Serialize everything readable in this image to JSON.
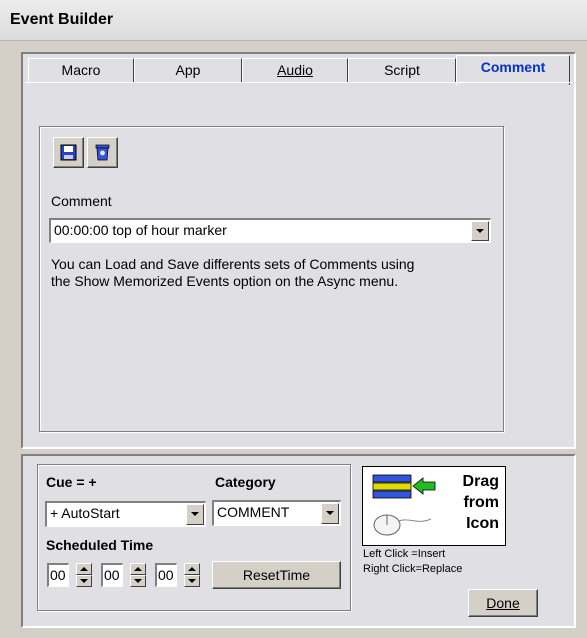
{
  "window": {
    "title": "Event Builder"
  },
  "tabs": [
    {
      "label": "Macro",
      "active": false
    },
    {
      "label": "App",
      "active": false
    },
    {
      "label": "Audio",
      "active": false
    },
    {
      "label": "Script",
      "active": false
    },
    {
      "label": "Comment",
      "active": true
    }
  ],
  "comment_page": {
    "icons": [
      "save-icon",
      "delete-icon"
    ],
    "comment_label": "Comment",
    "comment_value": "00:00:00 top of hour marker",
    "help_line1": "You can Load and Save differents sets of Comments using",
    "help_line2": "the Show Memorized Events option on the Async menu."
  },
  "bottom": {
    "cue_label": "Cue = +",
    "cue_value": "+ AutoStart",
    "category_label": "Category",
    "category_value": "COMMENT",
    "scheduled_label": "Scheduled Time",
    "hours": "00",
    "minutes": "00",
    "seconds": "00",
    "reset_label": "ResetTime",
    "drag_line1": "Drag",
    "drag_line2": "from",
    "drag_line3": "Icon",
    "left_click_hint": "Left Click  =Insert",
    "right_click_hint": "Right Click=Replace",
    "done_label": "Done"
  },
  "colors": {
    "active_tab": "#0033cc",
    "panel": "#e0dfe3",
    "face": "#d4d0c8"
  }
}
